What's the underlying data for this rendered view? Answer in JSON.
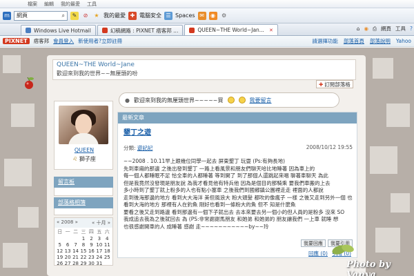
{
  "browser": {
    "menu": [
      "檔案",
      "編輯",
      "我的最愛",
      "工具"
    ],
    "search": {
      "value": "網頁"
    },
    "toolbar": [
      {
        "label": "我的最愛",
        "icon": "star-icon"
      },
      {
        "label": "電腦安全",
        "icon": "shield-icon"
      },
      {
        "label": "Spaces",
        "icon": "spaces-icon"
      }
    ],
    "tabs": [
      {
        "label": "Windows Live Hotmail",
        "active": false
      },
      {
        "label": "幻稿網路 : PIXNET 痞客邦 ...",
        "active": false
      },
      {
        "label": "QUEEN~THE World~Jan...",
        "active": true
      }
    ],
    "right_tools": [
      "網頁",
      "工具"
    ]
  },
  "site": {
    "logo": "PIXNET",
    "brand": "痞客邦",
    "links": [
      "會員登入",
      "新使用者?立即註冊"
    ],
    "right_links": [
      "請選擇功能",
      "部落首頁",
      "部落說明",
      "Yahoo"
    ]
  },
  "blog": {
    "title": "QUEEN~THE World~Jane",
    "subtitle": "歡迎來到我的世界~~無厘頭的吩",
    "subscribe": "訂閱部落格",
    "greeting": "歡迎來到我的無厘頭世界~~~~~買",
    "greeting_link": "我要留言"
  },
  "profile": {
    "name": "QUEEN",
    "sign": "獅子座"
  },
  "sidebar": {
    "guestbook": "留言板",
    "categories": "部落格相簿"
  },
  "calendar": {
    "year": "2008",
    "month": "十月",
    "days_head": [
      "日",
      "一",
      "二",
      "三",
      "四",
      "五",
      "六"
    ],
    "rows": [
      [
        "",
        "",
        "",
        "1",
        "2",
        "3",
        "4"
      ],
      [
        "5",
        "6",
        "7",
        "8",
        "9",
        "10",
        "11"
      ],
      [
        "12",
        "13",
        "14",
        "15",
        "16",
        "17",
        "18"
      ],
      [
        "19",
        "20",
        "21",
        "22",
        "23",
        "24",
        "25"
      ],
      [
        "26",
        "27",
        "28",
        "29",
        "30",
        "31",
        ""
      ]
    ]
  },
  "article": {
    "section": "最新文章",
    "title": "墾丁之遊",
    "category_label": "分類:",
    "category": "遊記記",
    "datetime": "2008/10/12 19:55",
    "body": [
      "~~2008 . 10.11早上跟幾位同學一起去 屏東墾丁 玩耍 (Ps:有夠長地)",
      "先到車廂的那邊 之後出發到墾丁 一路上看風景和朋友們聊天哈比地睡著 因為車上的",
      "每一個人都睡眠不足 恰全車的人都睡著 等到開了 到了那個人還跳起來唱 聊著車聊天 為此",
      "但是我竟然沒發現是朋友說 為我才看見他有特兵他 因為是個目的那騎乘 要我們車搬的上去",
      "多小時到了墾丁就上粉多的人也有點小塞車 之後我們到國鄉鎮公園裡走走 裡面的人都說",
      "走到後海那邊的地方 看到大大海洋 美但風浪大 粉大頭髮 都吹的像瘋子 一樣 之後又走到另外一個 也可以",
      "看到大海的地方 那裡有人在釣魚 剛好也看到一條粉大的魚 但不 知是什麼魚",
      "要看之後又走到路邊 看到那邊有一個下子就出去 去本來要去另一個小的但人員的是粉多 沒來 SO",
      "我成追去我為之後就回去 為 (PS:非常謝謝馬朋友 和她弟 和她弟的 朋友讓我們 一上車 就睡 想",
      "也很感謝開車的人 成睡著 感謝 走~~~~~~~~~~~by~~玲"
    ],
    "actions": [
      "我要回應",
      "我要引用"
    ],
    "foot": [
      "回應 (0)",
      "引用 (0)"
    ]
  },
  "watermark": "Photo by Vanya"
}
